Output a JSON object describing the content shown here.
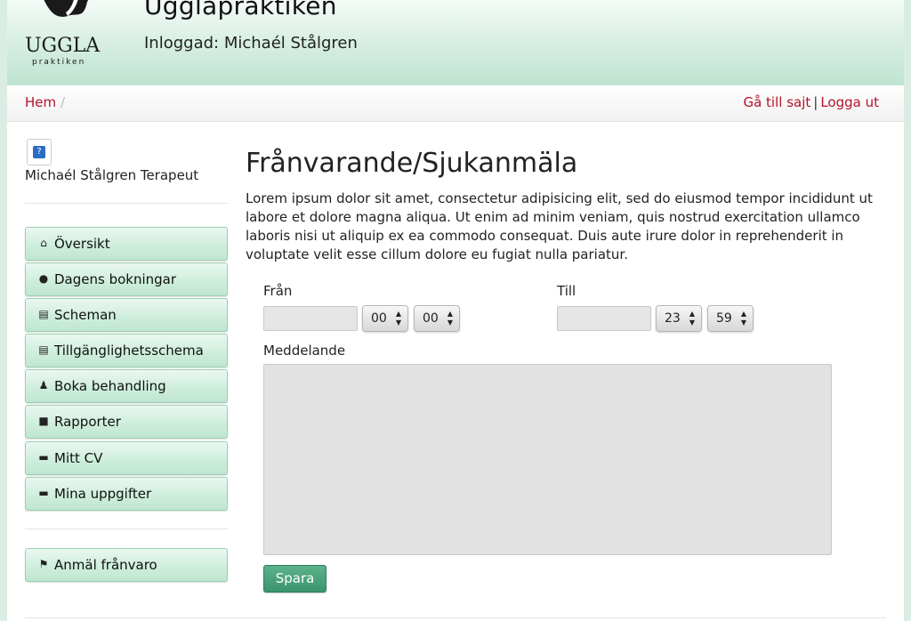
{
  "header": {
    "site_title": "Ugglapraktiken",
    "logged_in": "Inloggad: Michaél Stålgren",
    "logo_text": "UGGLA",
    "logo_sub": "praktiken"
  },
  "navbar": {
    "breadcrumb_home": "Hem",
    "breadcrumb_sep": "/",
    "goto_site": "Gå till sajt",
    "separator": "|",
    "logout": "Logga ut"
  },
  "sidebar": {
    "user_name": "Michaél Stålgren Terapeut",
    "avatar_icon": "help-icon",
    "items": [
      {
        "label": "Översikt",
        "icon": "home-icon"
      },
      {
        "label": "Dagens bokningar",
        "icon": "drop-icon"
      },
      {
        "label": "Scheman",
        "icon": "calendar-icon"
      },
      {
        "label": "Tillgänglighetsschema",
        "icon": "calendar-icon"
      },
      {
        "label": "Boka behandling",
        "icon": "user-icon"
      },
      {
        "label": "Rapporter",
        "icon": "book-icon"
      },
      {
        "label": "Mitt CV",
        "icon": "folder-icon"
      },
      {
        "label": "Mina uppgifter",
        "icon": "folder-icon"
      }
    ],
    "absence_item": {
      "label": "Anmäl frånvaro",
      "icon": "flag-icon"
    }
  },
  "main": {
    "title": "Frånvarande/Sjukanmäla",
    "description": "Lorem ipsum dolor sit amet, consectetur adipisicing elit, sed do eiusmod tempor incididunt ut labore et dolore magna aliqua. Ut enim ad minim veniam, quis nostrud exercitation ullamco laboris nisi ut aliquip ex ea commodo consequat. Duis aute irure dolor in reprehenderit in voluptate velit esse cillum dolore eu fugiat nulla pariatur.",
    "from": {
      "label": "Från",
      "date": "",
      "hour": "00",
      "minute": "00"
    },
    "to": {
      "label": "Till",
      "date": "",
      "hour": "23",
      "minute": "59"
    },
    "message": {
      "label": "Meddelande",
      "value": ""
    },
    "save_label": "Spara"
  },
  "colors": {
    "accent_red": "#b5132b",
    "header_green": "#bfe4d1",
    "save_green": "#3b9570"
  }
}
